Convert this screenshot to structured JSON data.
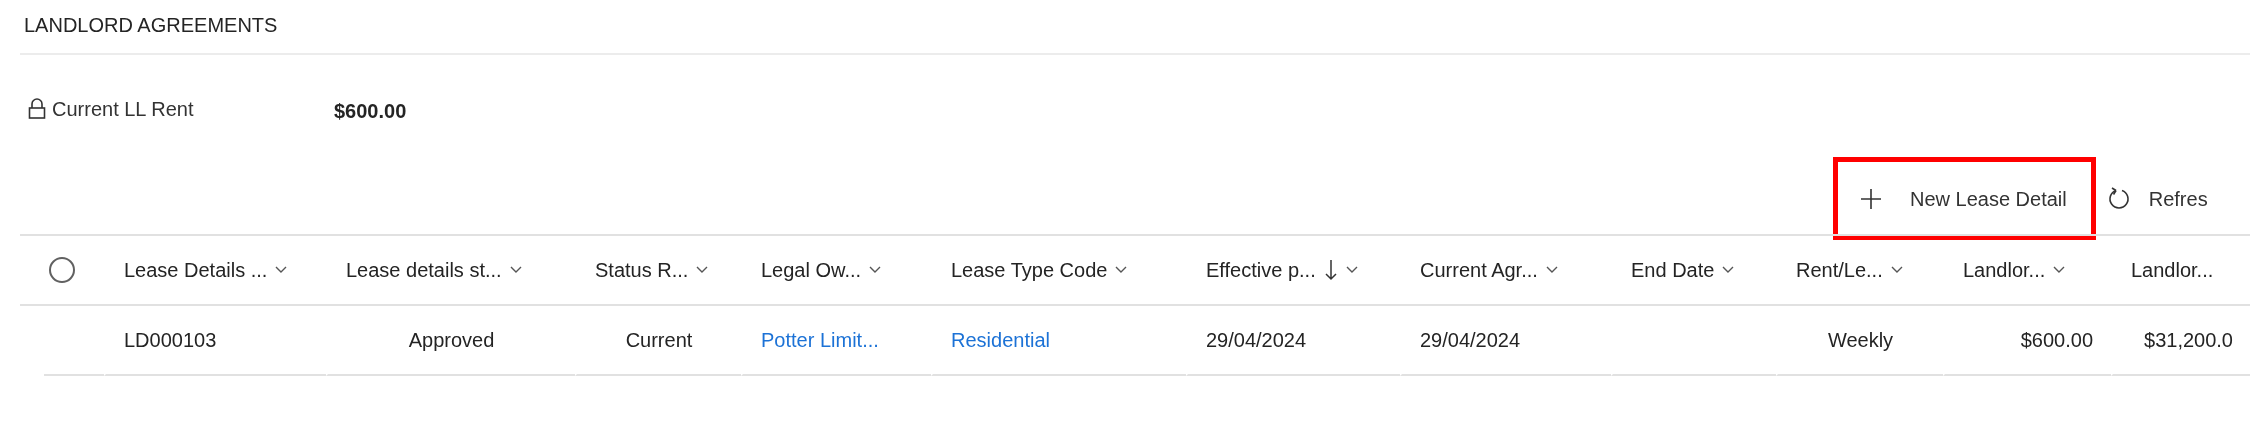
{
  "section": {
    "title": "LANDLORD AGREEMENTS"
  },
  "fields": [
    {
      "label": "Current LL Rent",
      "locked": true,
      "value": "$600.00"
    }
  ],
  "toolbar": [
    {
      "kind": "new",
      "label": "New Lease Detail",
      "highlighted": true
    },
    {
      "kind": "refresh",
      "label": "Refres",
      "highlighted": false
    }
  ],
  "table": {
    "select_all": {
      "checked": false
    },
    "columns": [
      {
        "label": "Lease Details ...",
        "sorted": false,
        "menu": true
      },
      {
        "label": "Lease details st...",
        "sorted": false,
        "menu": true
      },
      {
        "label": "Status R...",
        "sorted": false,
        "menu": true
      },
      {
        "label": "Legal Ow...",
        "sorted": false,
        "menu": true
      },
      {
        "label": "Lease Type Code",
        "sorted": false,
        "menu": true
      },
      {
        "label": "Effective p...",
        "sorted": true,
        "menu": true
      },
      {
        "label": "Current Agr...",
        "sorted": false,
        "menu": true
      },
      {
        "label": "End Date",
        "sorted": false,
        "menu": true
      },
      {
        "label": "Rent/Le...",
        "sorted": false,
        "menu": true
      },
      {
        "label": "Landlor...",
        "sorted": false,
        "menu": true
      },
      {
        "label": "Landlor..."
      }
    ],
    "rows": [
      {
        "cells": [
          {
            "text": "LD000103",
            "kind": "text"
          },
          {
            "text": "Approved",
            "kind": "text"
          },
          {
            "text": "Current",
            "kind": "text"
          },
          {
            "text": "Potter Limit...",
            "kind": "link"
          },
          {
            "text": "Residential",
            "kind": "link"
          },
          {
            "text": "29/04/2024",
            "kind": "text"
          },
          {
            "text": "29/04/2024",
            "kind": "text"
          },
          {
            "kind": "empty"
          },
          {
            "text": "Weekly",
            "kind": "text"
          },
          {
            "text": "$600.00",
            "kind": "text"
          },
          {
            "text": "$31,200.0",
            "kind": "text"
          }
        ]
      }
    ]
  }
}
